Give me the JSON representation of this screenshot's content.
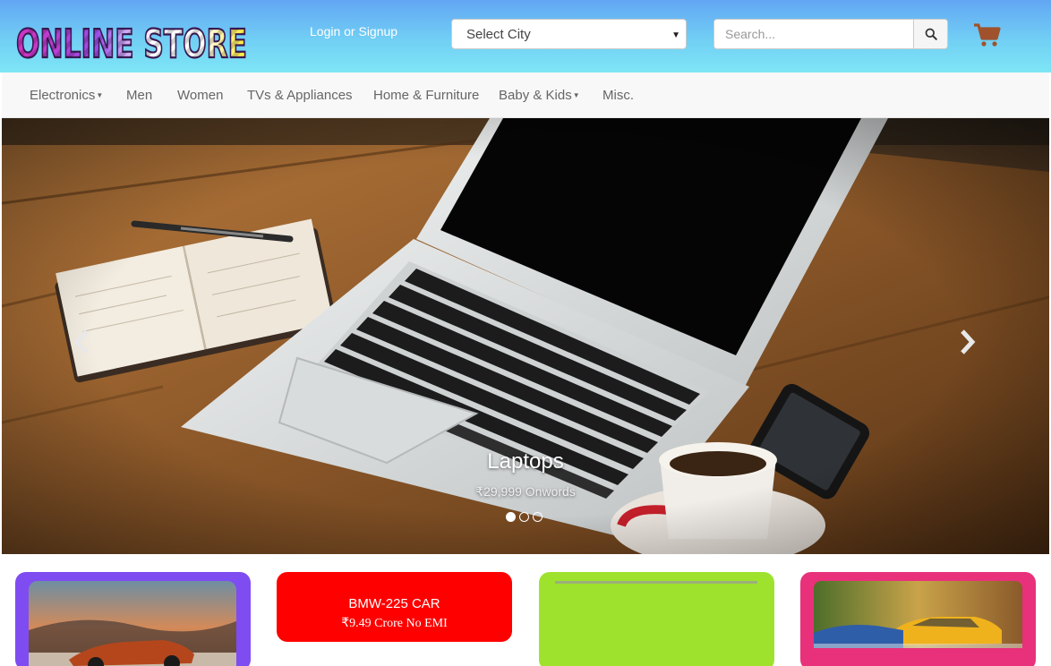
{
  "header": {
    "logo_text": "ONLINE STORE",
    "login_label": "Login or Signup",
    "city_select": {
      "selected": "Select City"
    },
    "search": {
      "placeholder": "Search..."
    },
    "icons": {
      "search": "search-icon",
      "cart": "cart-icon"
    }
  },
  "nav": {
    "items": [
      {
        "label": "Electronics",
        "dropdown": true
      },
      {
        "label": "Men",
        "dropdown": false
      },
      {
        "label": "Women",
        "dropdown": false
      },
      {
        "label": "TVs & Appliances",
        "dropdown": false
      },
      {
        "label": "Home & Furniture",
        "dropdown": false
      },
      {
        "label": "Baby & Kids",
        "dropdown": true
      },
      {
        "label": "Misc.",
        "dropdown": false
      }
    ]
  },
  "carousel": {
    "caption_title": "Laptops",
    "caption_subtitle": "₹29,999 Onwords",
    "slide_count": 3,
    "active_slide": 1,
    "icons": {
      "prev": "chevron-left-icon",
      "next": "chevron-right-icon"
    }
  },
  "cards": [
    {
      "kind": "image",
      "subject": "sports car in desert",
      "bg_color": "#7f4cf1"
    },
    {
      "kind": "text",
      "title": "BMW-225 CAR",
      "subtitle": "₹9.49 Crore No EMI",
      "bg_color": "#ff0000"
    },
    {
      "kind": "image",
      "subject": "blank",
      "bg_color": "#9ee22e"
    },
    {
      "kind": "image",
      "subject": "vintage yellow car",
      "bg_color": "#e8317a"
    }
  ],
  "colors": {
    "header_gradient_top": "#62a6f4",
    "header_gradient_bottom": "#7ee6f6",
    "cart": "#a0522d"
  }
}
